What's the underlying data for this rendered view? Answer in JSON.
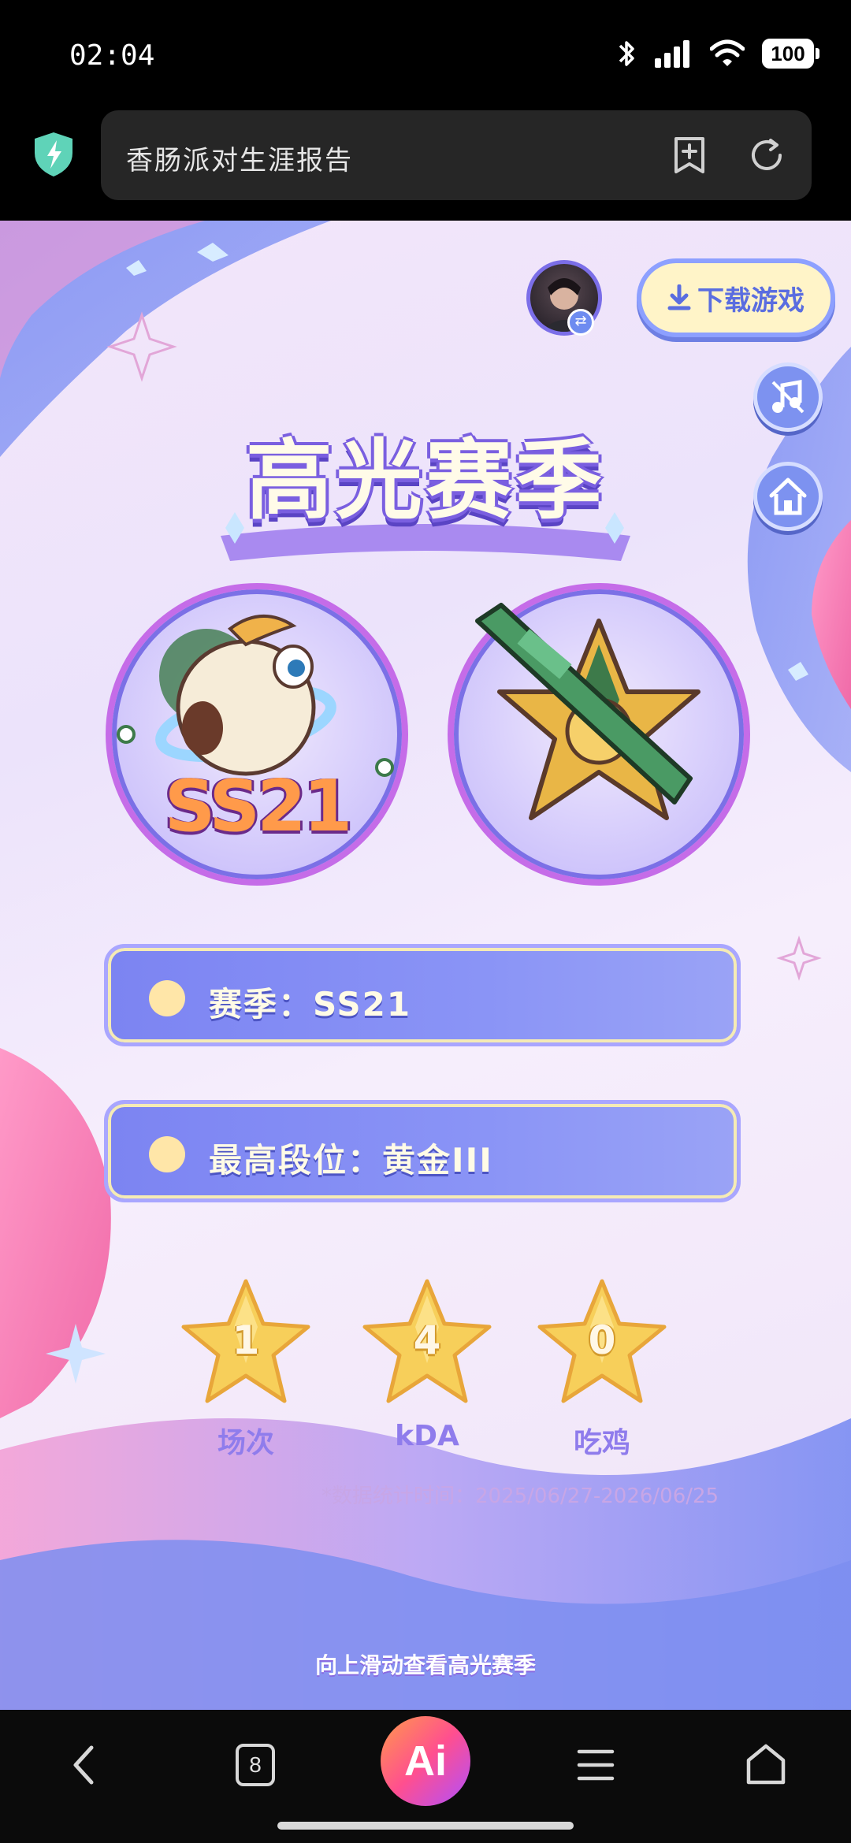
{
  "status_bar": {
    "time": "02:04",
    "battery": "100"
  },
  "browser": {
    "page_title": "香肠派对生涯报告"
  },
  "page": {
    "download_label": "下载游戏",
    "title": "高光赛季",
    "season_badge_text": "SS21",
    "info_rows": [
      {
        "label": "赛季：SS21"
      },
      {
        "label": "最高段位：黄金III"
      }
    ],
    "stats": [
      {
        "value": "1",
        "label": "场次"
      },
      {
        "value": "4",
        "label": "kDA"
      },
      {
        "value": "0",
        "label": "吃鸡"
      }
    ],
    "footnote": "*数据统计时间：2025/06/27-2026/06/25",
    "swipe_hint": "向上滑动查看高光赛季"
  },
  "bottom_nav": {
    "tab_count": "8",
    "ai_label": "Ai"
  },
  "colors": {
    "accent_purple": "#7b6ee8",
    "card_blue": "#8a94f6",
    "star_gold": "#f5c84a",
    "ai_gradient_start": "#ff9a4a",
    "ai_gradient_end": "#b04fff"
  }
}
